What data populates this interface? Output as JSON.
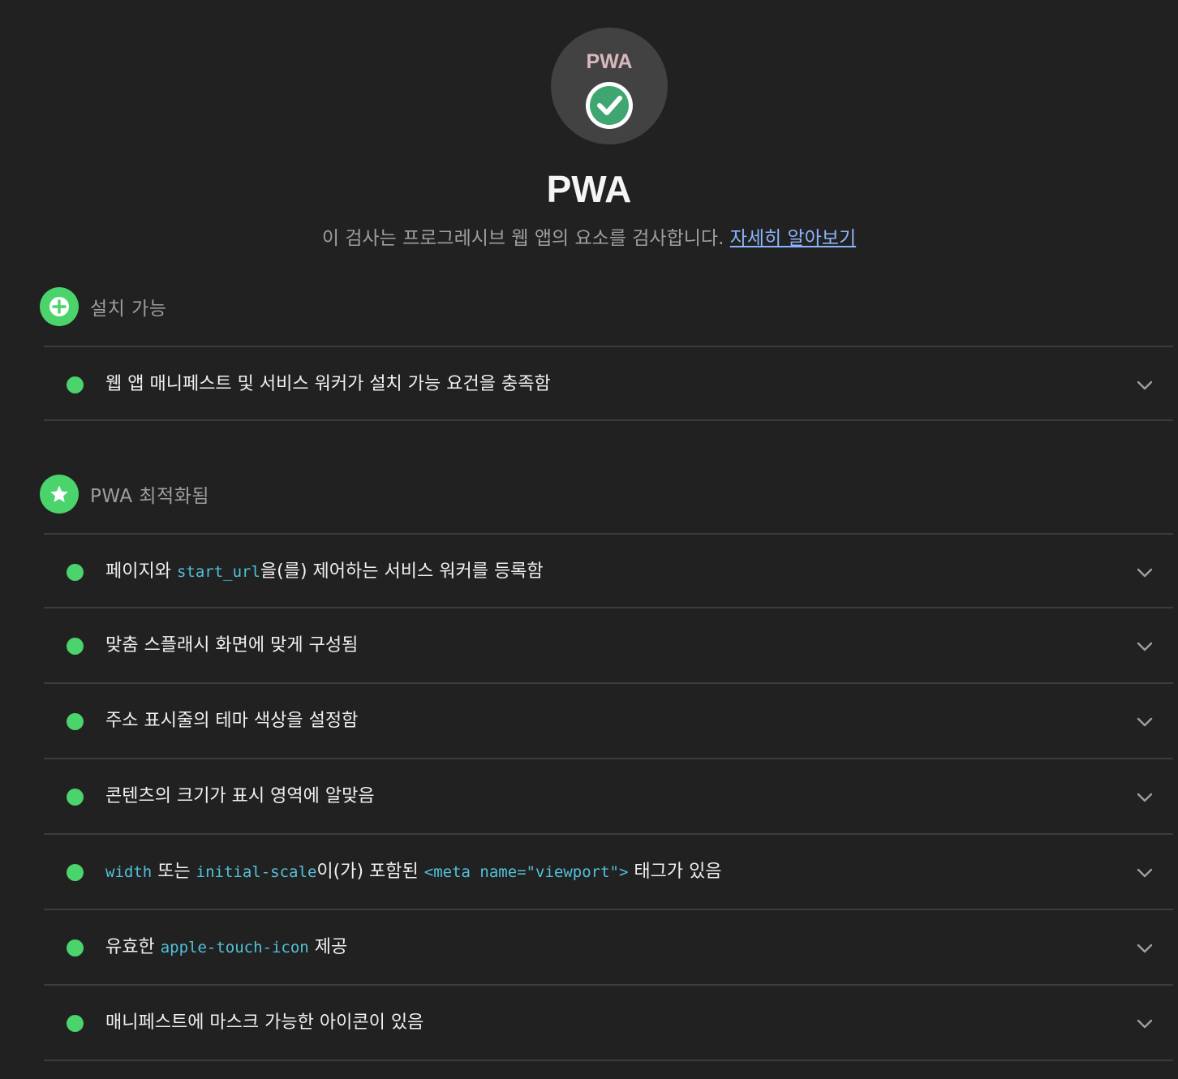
{
  "header": {
    "gauge_logo_text": "PWA",
    "title": "PWA",
    "description": "이 검사는 프로그레시브 웹 앱의 요소를 검사합니다.",
    "learn_more": "자세히 알아보기",
    "icons": {
      "badge": "check-circle-icon",
      "check_color": "#3ea66e"
    }
  },
  "colors": {
    "pass": "#4bd36c",
    "code": "#51c1d9",
    "link": "#8ab4f8",
    "background": "#212121"
  },
  "groups": [
    {
      "title": "설치 가능",
      "icon": "plus-circle-icon",
      "audits": [
        {
          "status": "pass",
          "parts": [
            "웹 앱 매니페스트 및 서비스 워커가 설치 가능 요건을 충족함"
          ]
        }
      ]
    },
    {
      "title": "PWA 최적화됨",
      "icon": "star-circle-icon",
      "audits": [
        {
          "status": "pass",
          "parts": [
            "페이지와 ",
            "start_url",
            "을(를) 제어하는 서비스 워커를 등록함"
          ]
        },
        {
          "status": "pass",
          "parts": [
            "맞춤 스플래시 화면에 맞게 구성됨"
          ]
        },
        {
          "status": "pass",
          "parts": [
            "주소 표시줄의 테마 색상을 설정함"
          ]
        },
        {
          "status": "pass",
          "parts": [
            "콘텐츠의 크기가 표시 영역에 알맞음"
          ]
        },
        {
          "status": "pass",
          "parts": [
            "width",
            " 또는 ",
            "initial-scale",
            "이(가) 포함된 ",
            "<meta name=\"viewport\">",
            " 태그가 있음"
          ]
        },
        {
          "status": "pass",
          "parts": [
            "유효한 ",
            "apple-touch-icon",
            " 제공"
          ]
        },
        {
          "status": "pass",
          "parts": [
            "매니페스트에 마스크 가능한 아이콘이 있음"
          ]
        }
      ]
    }
  ]
}
